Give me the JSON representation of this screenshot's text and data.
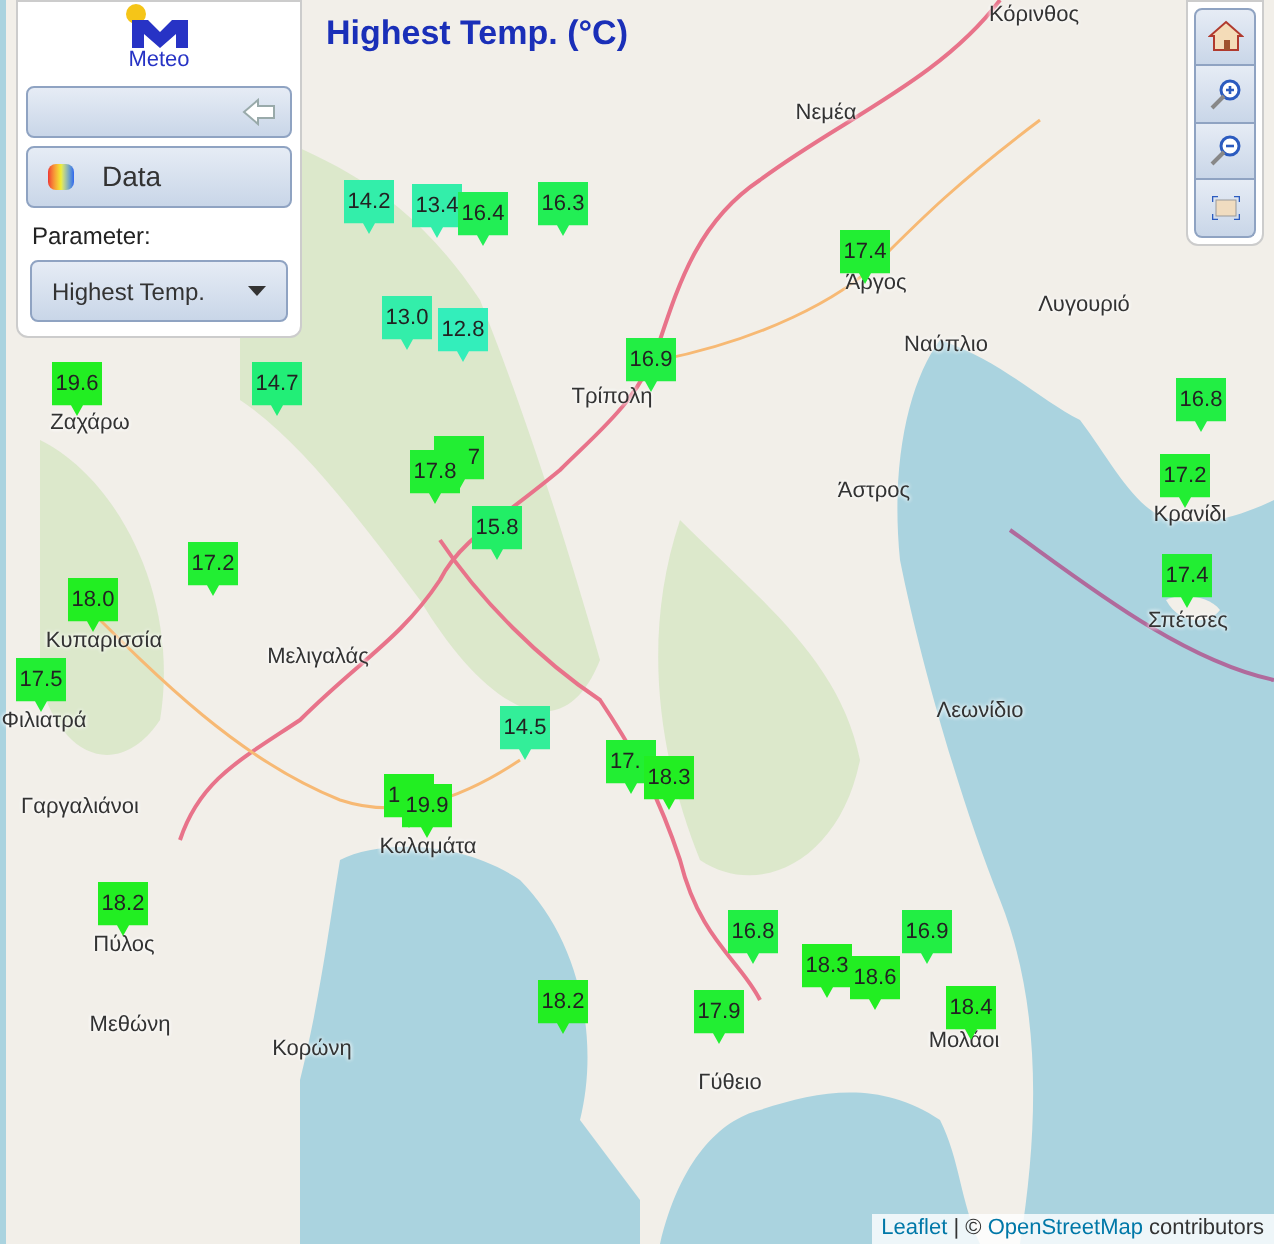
{
  "title": "Highest Temp. (°C)",
  "panel": {
    "logo_text": "Meteo",
    "data_button": "Data",
    "parameter_label": "Parameter:",
    "parameter_select": "Highest Temp."
  },
  "map_labels": [
    "Κόρινθος",
    "Νεμέα",
    "Άργος",
    "Λυγουριό",
    "Ναύπλιο",
    "Τρίπολη",
    "Ζαχάρω",
    "Άστρος",
    "Κρανίδι",
    "Σπέτσες",
    "Κυπαρισσία",
    "Μελιγαλάς",
    "Φιλιατρά",
    "Λεωνίδιο",
    "Γαργαλιάνοι",
    "Καλαμάτα",
    "Πύλος",
    "Μεθώνη",
    "Κορώνη",
    "Γύθειο",
    "Μολάοι"
  ],
  "markers": [
    {
      "value": "14.2",
      "color": "#33eeaa"
    },
    {
      "value": "13.4",
      "color": "#33eeaa"
    },
    {
      "value": "16.4",
      "color": "#22ee55"
    },
    {
      "value": "16.3",
      "color": "#22ee55"
    },
    {
      "value": "13.0",
      "color": "#33eeaa"
    },
    {
      "value": "12.8",
      "color": "#33eebb"
    },
    {
      "value": "19.6",
      "color": "#22ee22"
    },
    {
      "value": "14.7",
      "color": "#22ee77"
    },
    {
      "value": "16.9",
      "color": "#22ee44"
    },
    {
      "value": "17.4",
      "color": "#22ee33"
    },
    {
      "value": "16.8",
      "color": "#22ee44"
    },
    {
      "value": "17.2",
      "color": "#22ee33"
    },
    {
      "value": "17.4",
      "color": "#22ee33"
    },
    {
      "value": "7",
      "color": "#22ee33"
    },
    {
      "value": "17.8",
      "color": "#22ee33"
    },
    {
      "value": "15.8",
      "color": "#22ee66"
    },
    {
      "value": "17.2",
      "color": "#22ee33"
    },
    {
      "value": "18.0",
      "color": "#22ee22"
    },
    {
      "value": "17.5",
      "color": "#22ee33"
    },
    {
      "value": "14.5",
      "color": "#33ee99"
    },
    {
      "value": "17.",
      "color": "#22ee33"
    },
    {
      "value": "18.3",
      "color": "#22ee22"
    },
    {
      "value": "1",
      "color": "#22ee22"
    },
    {
      "value": "19.9",
      "color": "#22ee22"
    },
    {
      "value": "18.2",
      "color": "#22ee22"
    },
    {
      "value": "16.8",
      "color": "#22ee44"
    },
    {
      "value": "16.9",
      "color": "#22ee44"
    },
    {
      "value": "18.3",
      "color": "#22ee22"
    },
    {
      "value": "18.6",
      "color": "#22ee22"
    },
    {
      "value": "18.2",
      "color": "#22ee22"
    },
    {
      "value": "17.9",
      "color": "#22ee33"
    },
    {
      "value": "18.4",
      "color": "#22ee22"
    }
  ],
  "attribution": {
    "leaflet": "Leaflet",
    "separator": "| ©",
    "osm": "OpenStreetMap",
    "suffix": "contributors"
  }
}
